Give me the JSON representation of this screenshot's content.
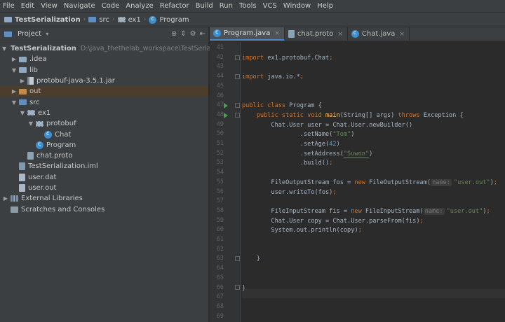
{
  "menubar": [
    "File",
    "Edit",
    "View",
    "Navigate",
    "Code",
    "Analyze",
    "Refactor",
    "Build",
    "Run",
    "Tools",
    "VCS",
    "Window",
    "Help"
  ],
  "breadcrumb": {
    "project": "TestSerialization",
    "src": "src",
    "pkg": "ex1",
    "cls": "Program"
  },
  "panel": {
    "title": "Project",
    "dropdown": "▾"
  },
  "tree": [
    {
      "label": "TestSerialization",
      "hint": "D:\\java_thethelab_workspace\\TestSerialization",
      "arrow": "▼",
      "icon": "folder-icon",
      "indent": 0
    },
    {
      "label": ".idea",
      "arrow": "▶",
      "icon": "folder-icon",
      "indent": 1
    },
    {
      "label": "lib",
      "arrow": "▼",
      "icon": "folder-icon",
      "indent": 1
    },
    {
      "label": "protobuf-java-3.5.1.jar",
      "arrow": "▶",
      "icon": "jar-icon",
      "indent": 2
    },
    {
      "label": "out",
      "arrow": "▶",
      "icon": "folder-icon",
      "indent": 1
    },
    {
      "label": "src",
      "arrow": "▼",
      "icon": "folder-icon",
      "indent": 1
    },
    {
      "label": "ex1",
      "arrow": "▼",
      "icon": "package-icon",
      "indent": 2
    },
    {
      "label": "protobuf",
      "arrow": "▼",
      "icon": "package-icon",
      "indent": 3
    },
    {
      "label": "Chat",
      "arrow": "",
      "icon": "class-icon",
      "indent": 4
    },
    {
      "label": "Program",
      "arrow": "",
      "icon": "class-icon",
      "indent": 3
    },
    {
      "label": "chat.proto",
      "arrow": "",
      "icon": "proto-file-icon",
      "indent": 2
    },
    {
      "label": "TestSerialization.iml",
      "arrow": "",
      "icon": "iml-file-icon",
      "indent": 1
    },
    {
      "label": "user.dat",
      "arrow": "",
      "icon": "file-icon",
      "indent": 1
    },
    {
      "label": "user.out",
      "arrow": "",
      "icon": "file-icon",
      "indent": 1
    },
    {
      "label": "External Libraries",
      "arrow": "▶",
      "icon": "libraries-icon",
      "indent": 0
    },
    {
      "label": "Scratches and Consoles",
      "arrow": "",
      "icon": "scratches-icon",
      "indent": 0
    }
  ],
  "tabs": [
    {
      "label": "Program.java",
      "active": true
    },
    {
      "label": "chat.proto",
      "active": false
    },
    {
      "label": "Chat.java",
      "active": false
    }
  ],
  "line_numbers": [
    "41",
    "42",
    "43",
    "44",
    "45",
    "46",
    "47",
    "48",
    "49",
    "50",
    "51",
    "52",
    "53",
    "54",
    "55",
    "56",
    "57",
    "58",
    "59",
    "60",
    "61",
    "62",
    "63",
    "64",
    "65",
    "66",
    "67",
    "68",
    "69"
  ],
  "code": {
    "l42a": "import ",
    "l42b": "ex1.protobuf.Chat",
    "l42c": ";",
    "l44a": "import ",
    "l44b": "java.io.*",
    "l44c": ";",
    "l47a": "public class ",
    "l47b": "Program {",
    "l48a": "    public static void ",
    "l48b": "main",
    "l48c": "(String[] args) ",
    "l48d": "throws ",
    "l48e": "Exception {",
    "l49": "        Chat.User user = Chat.User.newBuilder()",
    "l50a": "                .setName(",
    "l50b": "\"Tom\"",
    "l50c": ")",
    "l51a": "                .setAge(",
    "l51b": "42",
    "l51c": ")",
    "l52a": "                .setAddress(",
    "l52b": "\"Suwon\"",
    "l52c": ")",
    "l53": "                .build()",
    "l55a": "        FileOutputStream fos = ",
    "l55b": "new ",
    "l55c": "FileOutputStream(",
    "l55h": "name:",
    "l55d": "\"user.out\"",
    "l55e": ")",
    "l56": "        user.writeTo(fos)",
    "l58a": "        FileInputStream fis = ",
    "l58b": "new ",
    "l58c": "FileInputStream(",
    "l58h": "name:",
    "l58d": "\"user.out\"",
    "l58e": ")",
    "l59": "        Chat.User copy = Chat.User.parseFrom(fis)",
    "l60": "        System.out.println(copy)",
    "l63": "    }",
    "l66": "}",
    "semi": ";"
  }
}
